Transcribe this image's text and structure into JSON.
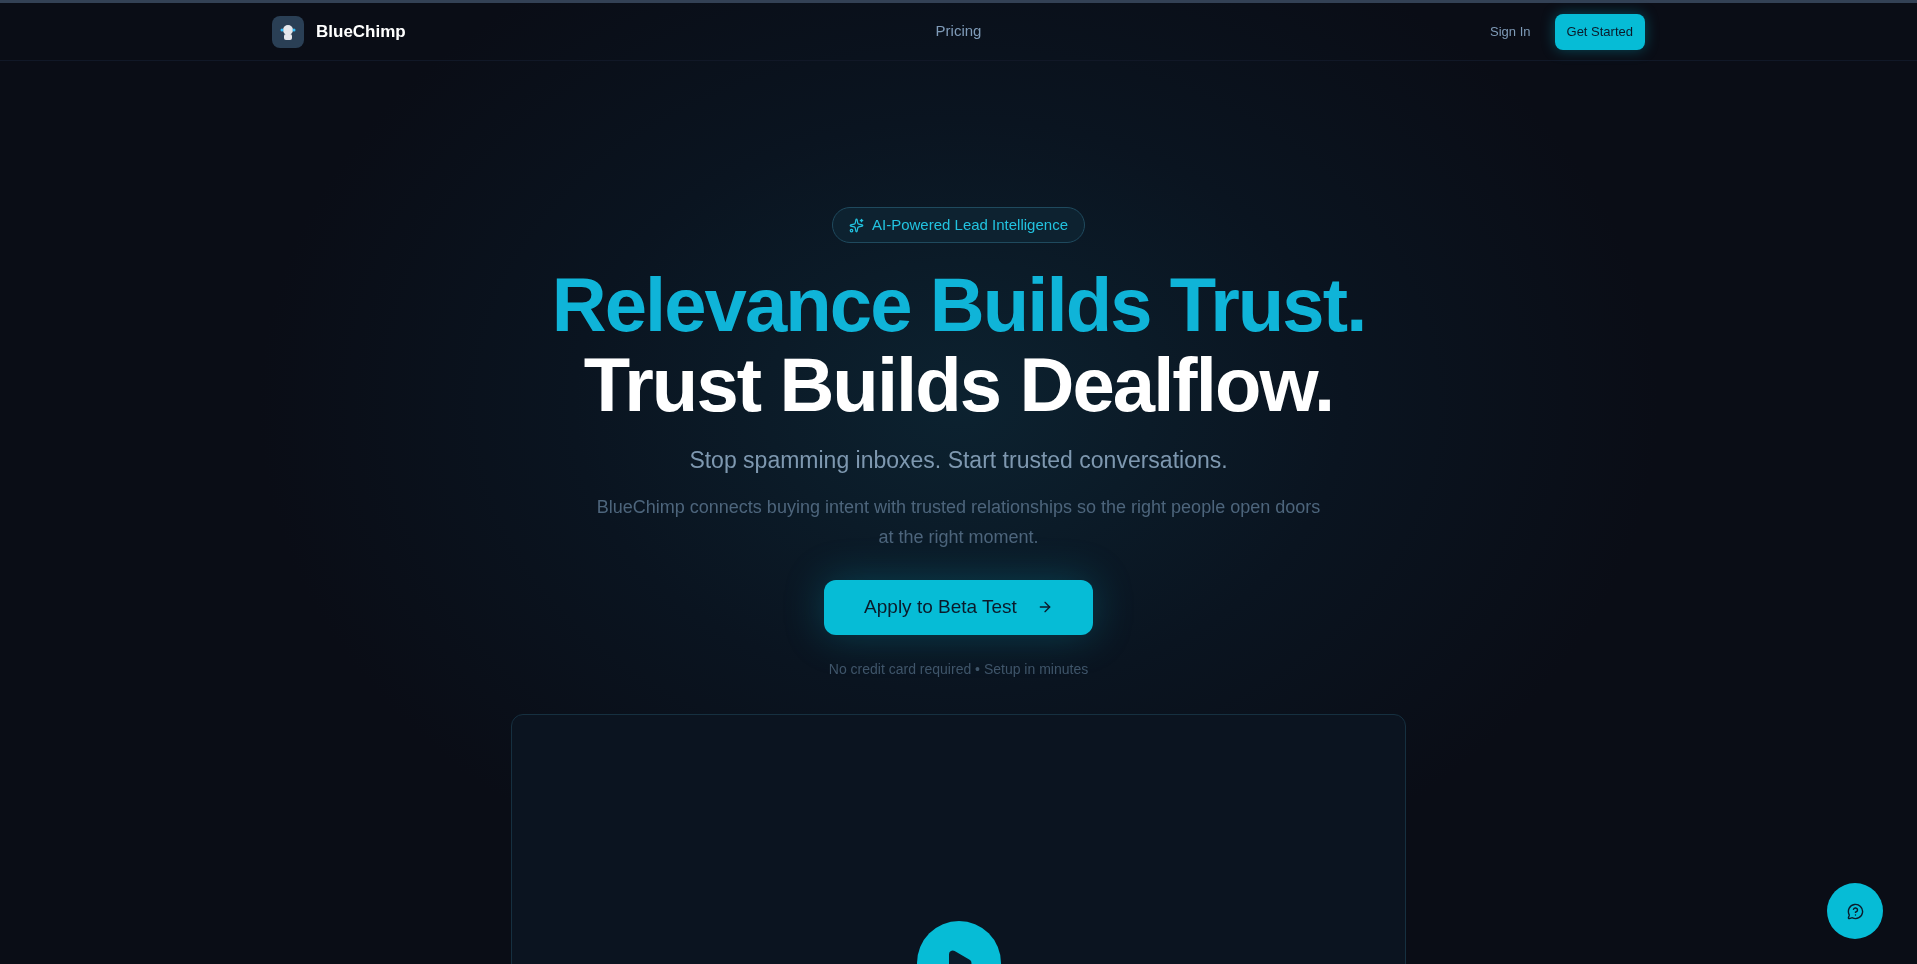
{
  "nav": {
    "brand": "BlueChimp",
    "links": [
      "Pricing"
    ],
    "sign_in": "Sign In",
    "cta": "Get Started"
  },
  "hero": {
    "badge": "AI-Powered Lead Intelligence",
    "headline_1": "Relevance Builds Trust.",
    "headline_2": "Trust Builds Dealflow.",
    "subtitle": "Stop spamming inboxes. Start trusted conversations.",
    "description": "BlueChimp connects buying intent with trusted relationships so the right people open doors at the right moment.",
    "button": "Apply to Beta Test",
    "note": "No credit card required • Setup in minutes"
  }
}
